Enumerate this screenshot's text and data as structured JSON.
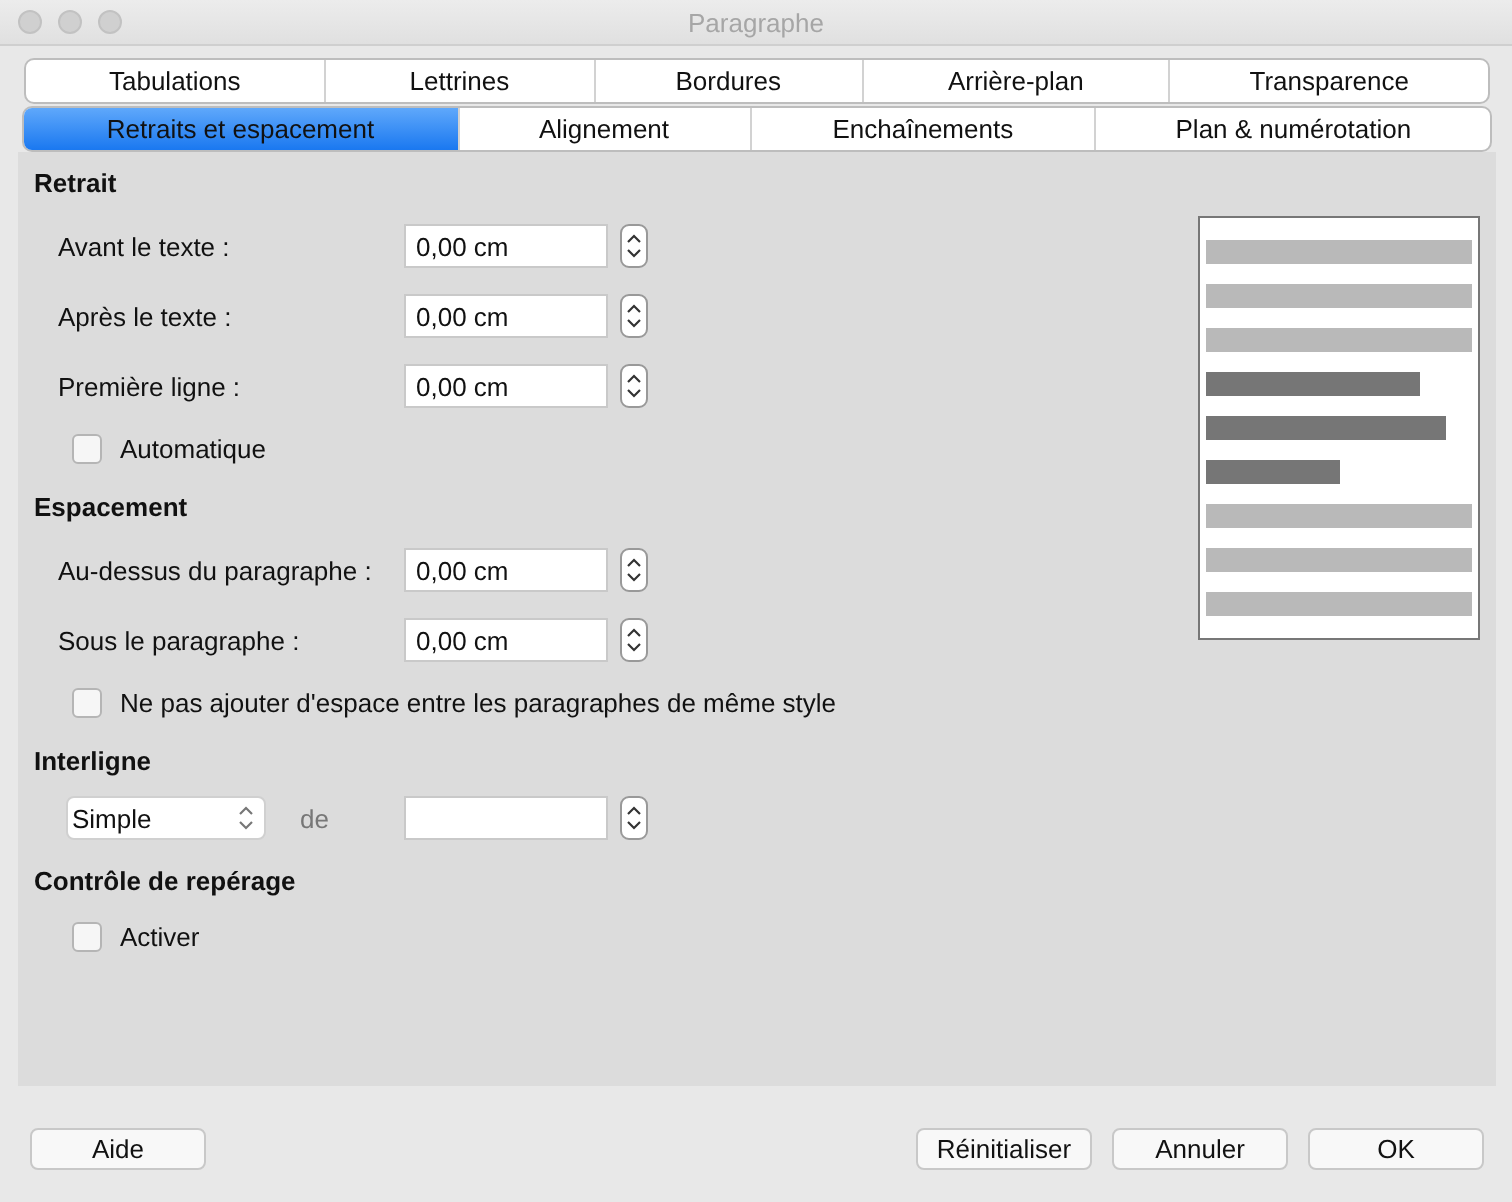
{
  "window": {
    "title": "Paragraphe"
  },
  "tab_rows": [
    [
      {
        "label": "Tabulations",
        "selected": false
      },
      {
        "label": "Lettrines",
        "selected": false
      },
      {
        "label": "Bordures",
        "selected": false
      },
      {
        "label": "Arrière-plan",
        "selected": false
      },
      {
        "label": "Transparence",
        "selected": false
      }
    ],
    [
      {
        "label": "Retraits et espacement",
        "selected": true
      },
      {
        "label": "Alignement",
        "selected": false
      },
      {
        "label": "Enchaînements",
        "selected": false
      },
      {
        "label": "Plan & numérotation",
        "selected": false
      }
    ]
  ],
  "sections": [
    {
      "title": "Retrait",
      "items": [
        {
          "kind": "spin",
          "label": "Avant le texte :",
          "value": "0,00 cm"
        },
        {
          "kind": "spin",
          "label": "Après le texte :",
          "value": "0,00 cm"
        },
        {
          "kind": "spin",
          "label": "Première ligne :",
          "value": "0,00 cm"
        },
        {
          "kind": "checkbox",
          "label": "Automatique",
          "checked": false
        }
      ]
    },
    {
      "title": "Espacement",
      "items": [
        {
          "kind": "spin",
          "label": "Au-dessus du paragraphe :",
          "value": "0,00 cm"
        },
        {
          "kind": "spin",
          "label": "Sous le paragraphe :",
          "value": "0,00 cm"
        },
        {
          "kind": "checkbox",
          "label": "Ne pas ajouter d'espace entre les paragraphes de même style",
          "checked": false
        }
      ]
    },
    {
      "title": "Interligne",
      "items": [
        {
          "kind": "spacing",
          "value": "Simple",
          "label": "de"
        }
      ]
    },
    {
      "title": "Contrôle de repérage",
      "items": [
        {
          "kind": "checkbox",
          "label": "Activer",
          "checked": false
        }
      ]
    }
  ],
  "buttons_left": [
    "Aide"
  ],
  "buttons_right": [
    "Réinitialiser",
    "Annuler",
    "OK"
  ]
}
